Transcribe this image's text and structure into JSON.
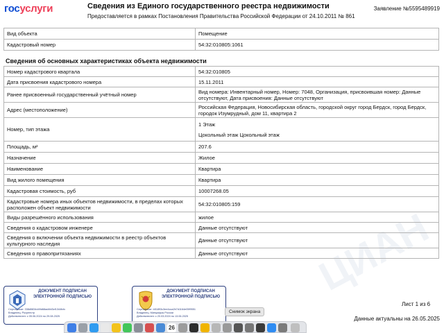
{
  "header": {
    "logo_part1": "гос",
    "logo_part2": "услуги",
    "title": "Сведения из Единого государственного реестра недвижимости",
    "subtitle": "Предоставляется в рамках Постановления Правительства Российской Федерации от 24.10.2011 № 861",
    "application": "Заявление №5595489919"
  },
  "top_table": [
    {
      "label": "Вид объекта",
      "value": "Помещение"
    },
    {
      "label": "Кадастровый номер",
      "value": "54:32:010805:1061"
    }
  ],
  "section_title": "Сведения об основных характеристиках объекта недвижимости",
  "main_table": [
    {
      "label": "Номер кадастрового квартала",
      "value": "54:32:010805"
    },
    {
      "label": "Дата присвоения кадастрового номера",
      "value": "15.11.2011"
    },
    {
      "label": "Ранее присвоенный государственный учётный номер",
      "value": "Вид номера: Инвентарный номер, Номер: 7048, Организация, присвоившая номер: Данные отсутствуют, Дата присвоения: Данные отсутствуют"
    },
    {
      "label": "Адрес (местоположение)",
      "value": "Российская Федерация, Новосибирская область, городской округ город Бердск, город Бердск, городок Изумрудный, дом 11, квартира 2"
    },
    {
      "label": "Номер, тип этажа",
      "value": "1 Этаж",
      "value2": "Цокольный этаж Цокольный этаж"
    },
    {
      "label": "Площадь, м²",
      "value": "207.6"
    },
    {
      "label": "Назначение",
      "value": "Жилое"
    },
    {
      "label": "Наименование",
      "value": "Квартира"
    },
    {
      "label": "Вид жилого помещения",
      "value": "Квартира"
    },
    {
      "label": "Кадастровая стоимость, руб",
      "value": "10007268.05"
    },
    {
      "label": "Кадастровые номера иных объектов недвижимости, в пределах которых расположен объект недвижимости",
      "value": "54:32:010805:159"
    },
    {
      "label": "Виды разрешённого использования",
      "value": "жилое"
    },
    {
      "label": "Сведения о кадастровом инженере",
      "value": "Данные отсутствуют"
    },
    {
      "label": "Сведения о включении объекта недвижимости в реестр объектов культурного наследия",
      "value": "Данные отсутствуют"
    },
    {
      "label": "Сведения о правопритязаниях",
      "value": "Данные отсутствуют"
    }
  ],
  "stamps": [
    {
      "text": "ДОКУМЕНТ ПОДПИСАН ЭЛЕКТРОННОЙ ПОДПИСЬЮ",
      "cert": "Сертификат: 338d5834d49d68ad4fd3cf1344fcfc",
      "owner": "Владелец: Росреестр",
      "valid": "Действителен: с 05.06.2024 по 29.08.2025"
    },
    {
      "text": "ДОКУМЕНТ ПОДПИСАН ЭЛЕКТРОННОЙ ПОДПИСЬЮ",
      "cert": "Сертификат: b51893c3ee4cca2b7d1164e05f9551",
      "owner": "Владелец: Минцифры России",
      "valid": "Действителен: с 20.03.2024 по 13.06.2025"
    }
  ],
  "footer": {
    "page": "Лист 1 из 6",
    "actual": "Данные актуальны на 26.05.2025",
    "screenshot_tip": "Снимок экрана",
    "dock_date": "26"
  }
}
